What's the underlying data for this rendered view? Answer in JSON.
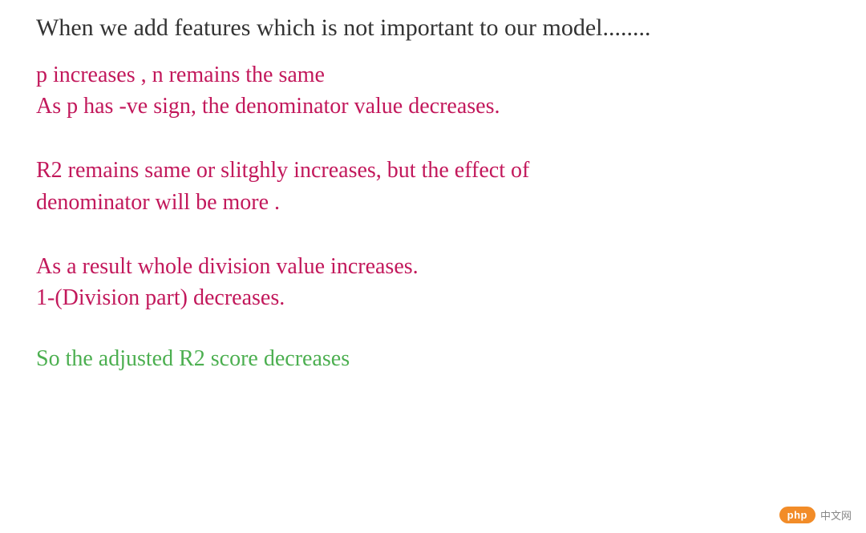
{
  "heading": "When we add features which is not important to our model........",
  "paragraphs": {
    "p1_line1": "p increases , n remains the same",
    "p1_line2": "As p has -ve sign, the denominator value decreases.",
    "p2_line1": "R2 remains same or slitghly increases, but the effect of",
    "p2_line2": "denominator will be more .",
    "p3_line1": "As a result whole division value increases.",
    "p3_line2": "1-(Division part) decreases."
  },
  "conclusion": "So the adjusted R2 score decreases",
  "watermark": {
    "pill": "php",
    "text": "中文网"
  }
}
